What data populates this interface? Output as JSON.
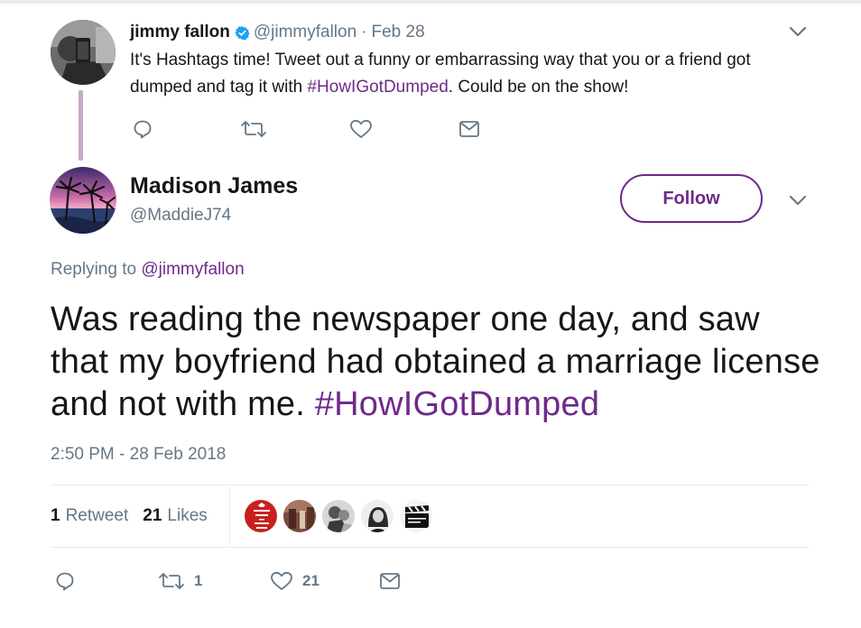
{
  "parent_tweet": {
    "name": "jimmy fallon",
    "handle": "@jimmyfallon",
    "separator": "·",
    "date": "Feb 28",
    "text_before": "It's Hashtags time! Tweet out a funny or embarrassing way that you or a friend got dumped and tag it with ",
    "hashtag": "#HowIGotDumped",
    "text_after": ". Could be on the show!",
    "verified_icon": "verified-badge-icon",
    "actions": [
      "reply-icon",
      "retweet-icon",
      "like-icon",
      "message-icon"
    ]
  },
  "main_tweet": {
    "name": "Madison James",
    "handle": "@MaddieJ74",
    "follow_label": "Follow",
    "replying_prefix": "Replying to",
    "replying_mention": "@jimmyfallon",
    "text": "Was reading the newspaper one day, and saw that my boyfriend had obtained a marriage license and not with me. ",
    "hashtag": "#HowIGotDumped",
    "timestamp": "2:50 PM - 28 Feb 2018",
    "stats": {
      "retweet_count": "1",
      "retweet_label": "Retweet",
      "like_count": "21",
      "like_label": "Likes"
    },
    "likers": [
      "keep-calm-avatar",
      "room-avatar",
      "couple-avatar",
      "woman-avatar",
      "clapperboard-avatar"
    ],
    "actions": {
      "reply_count": "",
      "retweet_count": "1",
      "like_count": "21"
    }
  },
  "colors": {
    "accent": "#6e2a8b",
    "secondary_text": "#657786",
    "thread_line": "#c9a9c9",
    "divider": "#e6ecf0"
  }
}
